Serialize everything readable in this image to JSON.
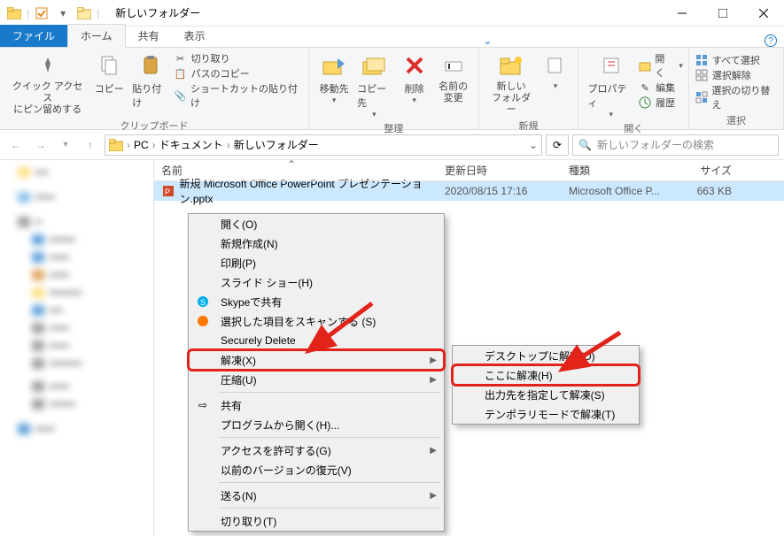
{
  "window": {
    "title": "新しいフォルダー"
  },
  "tabs": {
    "file": "ファイル",
    "home": "ホーム",
    "share": "共有",
    "view": "表示"
  },
  "ribbon": {
    "clipboard": {
      "pin": "クイック アクセス\nにピン留めする",
      "copy": "コピー",
      "paste": "貼り付け",
      "cut": "切り取り",
      "copypath": "パスのコピー",
      "shortcut": "ショートカットの貼り付け",
      "label": "クリップボード"
    },
    "organize": {
      "moveto": "移動先",
      "copyto": "コピー先",
      "delete": "削除",
      "rename": "名前の\n変更",
      "label": "整理"
    },
    "new": {
      "folder": "新しい\nフォルダー",
      "item": "",
      "label": "新規"
    },
    "open": {
      "properties": "プロパティ",
      "open": "開く",
      "edit": "編集",
      "history": "履歴",
      "label": "開く"
    },
    "select": {
      "all": "すべて選択",
      "none": "選択解除",
      "invert": "選択の切り替え",
      "label": "選択"
    }
  },
  "addr": {
    "pc": "PC",
    "docs": "ドキュメント",
    "folder": "新しいフォルダー"
  },
  "search": {
    "placeholder": "新しいフォルダーの検索"
  },
  "columns": {
    "name": "名前",
    "modified": "更新日時",
    "type": "種類",
    "size": "サイズ"
  },
  "file": {
    "name": "新規 Microsoft Office PowerPoint プレゼンテーション.pptx",
    "modified": "2020/08/15 17:16",
    "type": "Microsoft Office P...",
    "size": "663 KB"
  },
  "ctx1": {
    "open": "開く(O)",
    "new": "新規作成(N)",
    "print": "印刷(P)",
    "slideshow": "スライド ショー(H)",
    "skype": "Skypeで共有",
    "scan": "選択した項目をスキャンする (S)",
    "securedelete": "Securely Delete",
    "extract": "解凍(X)",
    "compress": "圧縮(U)",
    "share": "共有",
    "openwith": "プログラムから開く(H)...",
    "access": "アクセスを許可する(G)",
    "restore": "以前のバージョンの復元(V)",
    "sendto": "送る(N)",
    "cut": "切り取り(T)"
  },
  "ctx2": {
    "desktop": "デスクトップに解凍(D)",
    "here": "ここに解凍(H)",
    "output": "出力先を指定して解凍(S)",
    "temp": "テンポラリモードで解凍(T)"
  }
}
